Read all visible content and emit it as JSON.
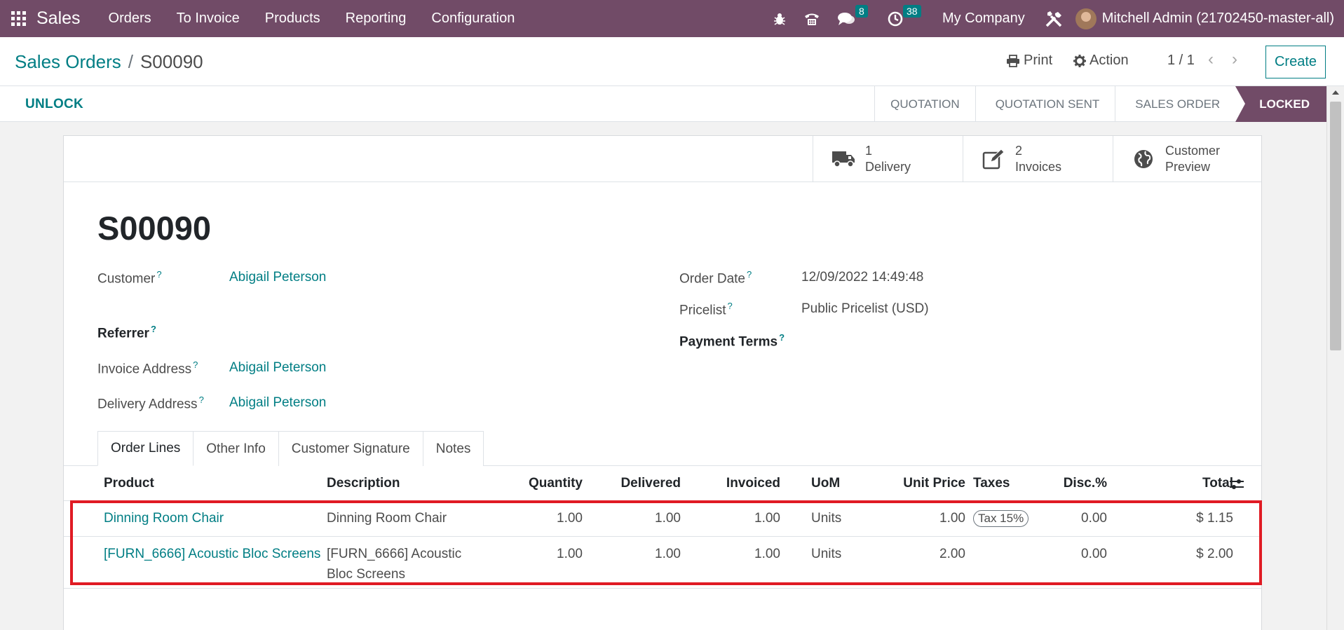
{
  "navbar": {
    "brand": "Sales",
    "menu": [
      "Orders",
      "To Invoice",
      "Products",
      "Reporting",
      "Configuration"
    ],
    "messages_badge": "8",
    "activities_badge": "38",
    "company": "My Company",
    "user": "Mitchell Admin (21702450-master-all)"
  },
  "control": {
    "breadcrumb_parent": "Sales Orders",
    "breadcrumb_current": "S00090",
    "print_label": "Print",
    "action_label": "Action",
    "pager": "1 / 1",
    "create_label": "Create"
  },
  "statusbar": {
    "unlock_label": "UNLOCK",
    "stages": [
      "QUOTATION",
      "QUOTATION SENT",
      "SALES ORDER",
      "LOCKED"
    ],
    "active_stage": "LOCKED"
  },
  "button_box": {
    "delivery_count": "1",
    "delivery_label": "Delivery",
    "invoices_count": "2",
    "invoices_label": "Invoices",
    "preview_line1": "Customer",
    "preview_line2": "Preview"
  },
  "form": {
    "name": "S00090",
    "customer_label": "Customer",
    "customer_value": "Abigail Peterson",
    "referrer_label": "Referrer",
    "invoice_address_label": "Invoice Address",
    "invoice_address_value": "Abigail Peterson",
    "delivery_address_label": "Delivery Address",
    "delivery_address_value": "Abigail Peterson",
    "order_date_label": "Order Date",
    "order_date_value": "12/09/2022 14:49:48",
    "pricelist_label": "Pricelist",
    "pricelist_value": "Public Pricelist (USD)",
    "payment_terms_label": "Payment Terms",
    "help_mark": "?"
  },
  "tabs": [
    "Order Lines",
    "Other Info",
    "Customer Signature",
    "Notes"
  ],
  "order_lines": {
    "headers": {
      "product": "Product",
      "description": "Description",
      "quantity": "Quantity",
      "delivered": "Delivered",
      "invoiced": "Invoiced",
      "uom": "UoM",
      "unit_price": "Unit Price",
      "taxes": "Taxes",
      "discount": "Disc.%",
      "total": "Total"
    },
    "rows": [
      {
        "product": "Dinning Room Chair",
        "description_line1": "Dinning Room Chair",
        "description_line2": "",
        "quantity": "1.00",
        "delivered": "1.00",
        "invoiced": "1.00",
        "uom": "Units",
        "unit_price": "1.00",
        "taxes": "Tax 15%",
        "discount": "0.00",
        "total": "$ 1.15"
      },
      {
        "product": "[FURN_6666] Acoustic Bloc Screens",
        "description_line1": "[FURN_6666] Acoustic",
        "description_line2": "Bloc Screens",
        "quantity": "1.00",
        "delivered": "1.00",
        "invoiced": "1.00",
        "uom": "Units",
        "unit_price": "2.00",
        "taxes": "",
        "discount": "0.00",
        "total": "$ 2.00"
      }
    ]
  },
  "colors": {
    "brand": "#714b67",
    "link": "#017e84",
    "highlight": "#e01b24"
  }
}
